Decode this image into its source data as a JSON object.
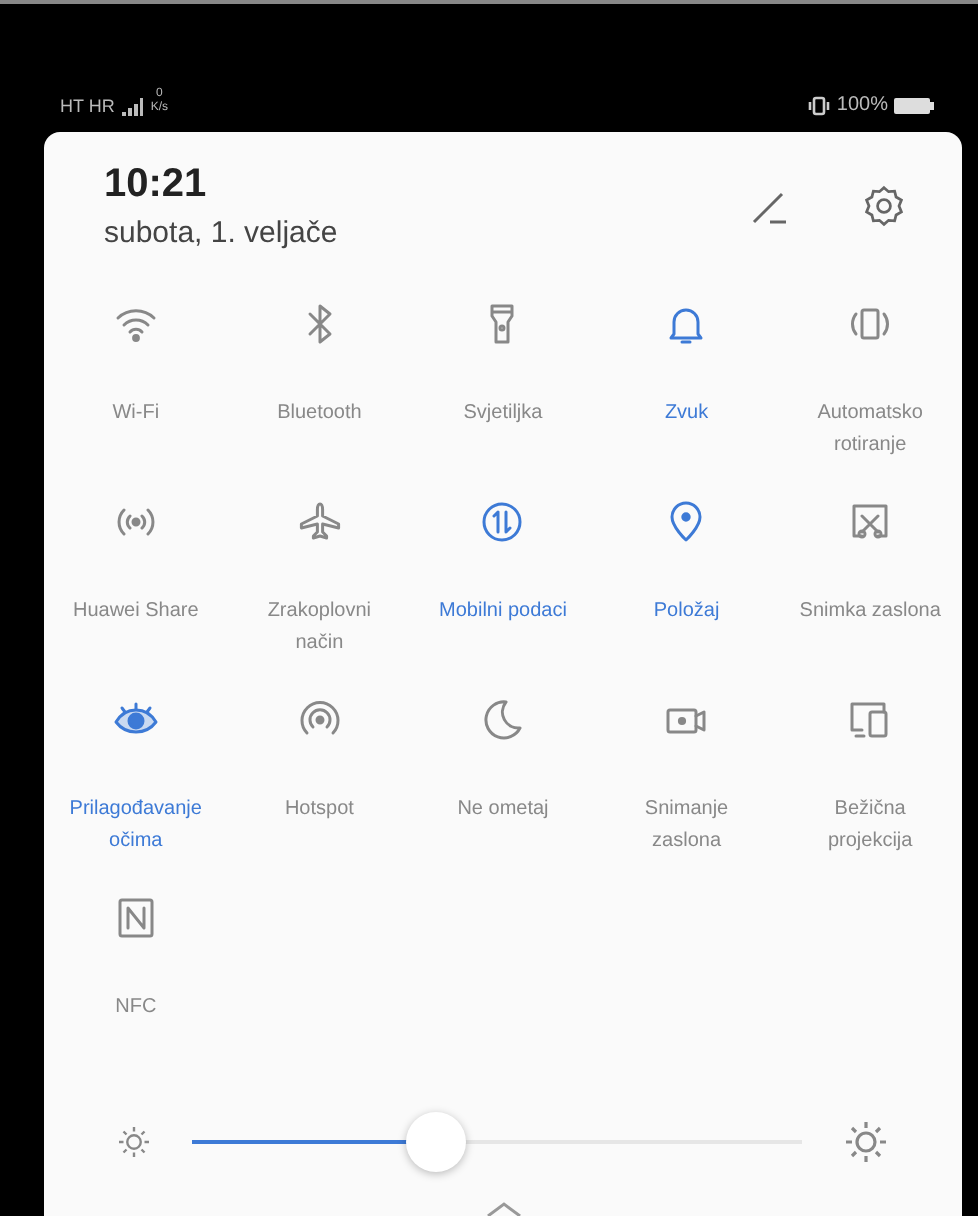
{
  "status_bar": {
    "carrier": "HT HR",
    "net_speed_value": "0",
    "net_speed_unit": "K/s",
    "battery": "100%"
  },
  "header": {
    "time": "10:21",
    "date": "subota, 1. veljače"
  },
  "tiles": [
    {
      "kind": "wifi",
      "label": "Wi-Fi",
      "on": false
    },
    {
      "kind": "bluetooth",
      "label": "Bluetooth",
      "on": false
    },
    {
      "kind": "flashlight",
      "label": "Svjetiljka",
      "on": false
    },
    {
      "kind": "sound",
      "label": "Zvuk",
      "on": true
    },
    {
      "kind": "rotate",
      "label": "Automatsko rotiranje",
      "on": false
    },
    {
      "kind": "share",
      "label": "Huawei Share",
      "on": false
    },
    {
      "kind": "airplane",
      "label": "Zrakoplovni način",
      "on": false
    },
    {
      "kind": "data",
      "label": "Mobilni podaci",
      "on": true
    },
    {
      "kind": "location",
      "label": "Položaj",
      "on": true
    },
    {
      "kind": "screenshot",
      "label": "Snimka zaslona",
      "on": false
    },
    {
      "kind": "eye",
      "label": "Prilagođavanje očima",
      "on": true
    },
    {
      "kind": "hotspot",
      "label": "Hotspot",
      "on": false
    },
    {
      "kind": "dnd",
      "label": "Ne ometaj",
      "on": false
    },
    {
      "kind": "record",
      "label": "Snimanje zaslona",
      "on": false
    },
    {
      "kind": "cast",
      "label": "Bežična projekcija",
      "on": false
    },
    {
      "kind": "nfc",
      "label": "NFC",
      "on": false
    }
  ],
  "brightness": {
    "level": 0.4
  }
}
